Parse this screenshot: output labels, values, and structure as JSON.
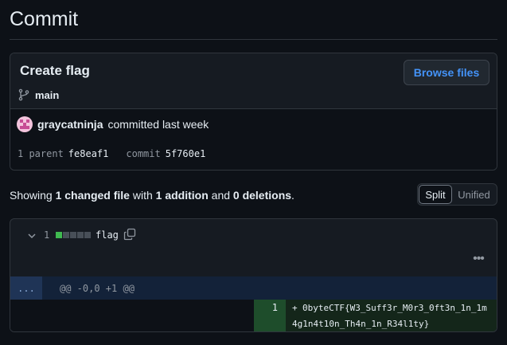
{
  "page": {
    "title": "Commit"
  },
  "commit": {
    "title": "Create flag",
    "browse_label": "Browse files",
    "branch": "main",
    "author": "graycatninja",
    "committed_text": "committed last week",
    "parent_label": "1 parent",
    "parent_sha": "fe8eaf1",
    "commit_label": "commit",
    "commit_sha": "5f760e1"
  },
  "summary": {
    "showing": "Showing",
    "files": "1 changed file",
    "with": "with",
    "additions": "1 addition",
    "and": "and",
    "deletions": "0 deletions",
    "end": "."
  },
  "view_toggle": {
    "split": "Split",
    "unified": "Unified",
    "selected": "Split"
  },
  "file": {
    "count": "1",
    "name": "flag",
    "diffstat": {
      "added_blocks": 1,
      "neutral_blocks": 4,
      "added_color": "#3fb950",
      "neutral_color": "#484f58"
    },
    "expand_label": "...",
    "hunk_header": "@@ -0,0 +1 @@",
    "line_number": "1",
    "line_sign": "+",
    "line_code": "0byteCTF{W3_Suff3r_M0r3_0ft3n_1n_1m4g1n4t10n_Th4n_1n_R34l1ty}"
  },
  "icons": {
    "branch": "git-branch-icon",
    "chevron": "chevron-down-icon",
    "copy": "copy-icon",
    "kebab": "kebab-horizontal-icon"
  },
  "colors": {
    "background": "#0d1117",
    "accent_link": "#4493f8",
    "addition_bg": "#14261a",
    "addition_num_bg": "#1e4d2b",
    "hunk_bg": "#132239"
  }
}
